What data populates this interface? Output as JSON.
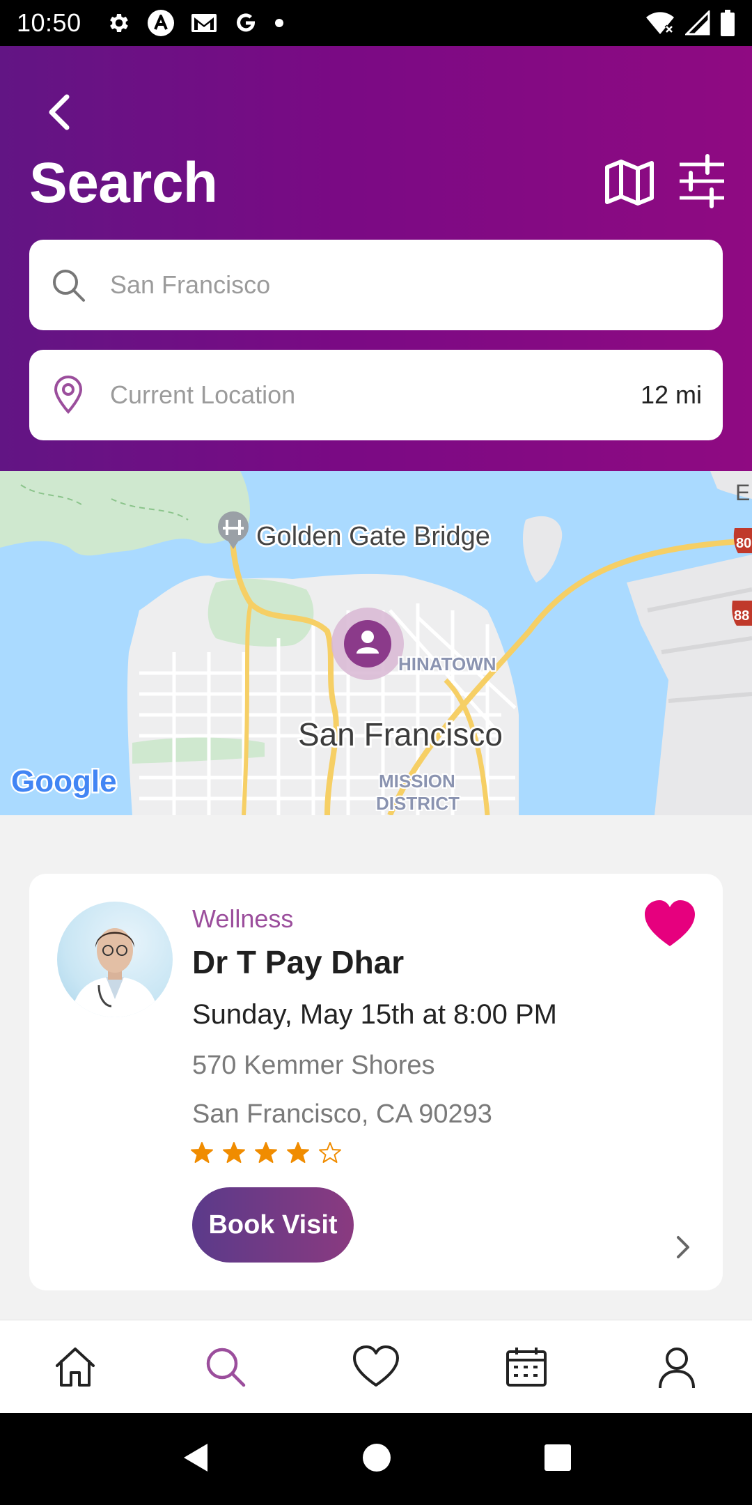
{
  "status_bar": {
    "time": "10:50",
    "left_icons": [
      "gear-icon",
      "app-a-icon",
      "gmail-icon",
      "google-icon",
      "dot-icon"
    ],
    "right_icons": [
      "wifi-icon",
      "signal-icon",
      "battery-icon"
    ]
  },
  "header": {
    "title": "Search",
    "search": {
      "placeholder": "San Francisco"
    },
    "location": {
      "placeholder": "Current Location",
      "distance": "12 mi"
    },
    "gradient_colors": [
      "#621584",
      "#8f0a82"
    ]
  },
  "map": {
    "labels": {
      "golden_gate": "Golden Gate Bridge",
      "chinatown": "HINATOWN",
      "city": "San Francisco",
      "mission_line1": "MISSION",
      "mission_line2": "DISTRICT",
      "google": "Google",
      "edge_e": "E",
      "shield_80": "80",
      "shield_88": "88"
    }
  },
  "result_card": {
    "category": "Wellness",
    "name": "Dr T Pay Dhar",
    "appointment": "Sunday, May 15th at 8:00 PM",
    "address_line1": "570 Kemmer Shores",
    "address_line2": "San Francisco, CA 90293",
    "rating": 4,
    "rating_max": 5,
    "book_label": "Book Visit",
    "favorite": true,
    "colors": {
      "star": "#f08c00",
      "heart": "#e6007e",
      "category": "#9b4e9c"
    }
  },
  "bottom_nav": {
    "items": [
      {
        "icon": "home-icon",
        "active": false
      },
      {
        "icon": "search-icon",
        "active": true
      },
      {
        "icon": "heart-icon",
        "active": false
      },
      {
        "icon": "calendar-icon",
        "active": false
      },
      {
        "icon": "profile-icon",
        "active": false
      }
    ],
    "active_color": "#9b4e9c"
  }
}
